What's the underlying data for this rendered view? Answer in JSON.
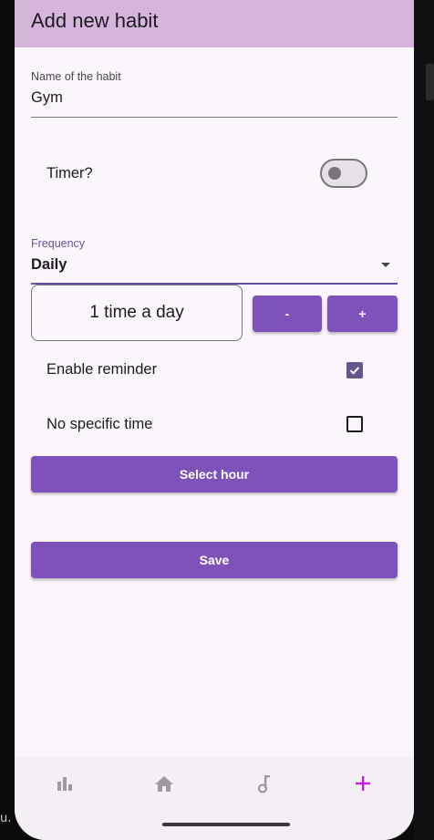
{
  "app_bar": {
    "title": "Add new habit"
  },
  "habit_name": {
    "label": "Name of the habit",
    "value": "Gym"
  },
  "timer": {
    "label": "Timer?",
    "enabled": false
  },
  "frequency": {
    "label": "Frequency",
    "value": "Daily"
  },
  "times_per_day": {
    "display": "1 time a day",
    "decrement_label": "-",
    "increment_label": "+"
  },
  "reminder": {
    "label": "Enable reminder",
    "checked": true
  },
  "no_specific_time": {
    "label": "No specific time",
    "checked": false
  },
  "select_hour": {
    "label": "Select hour"
  },
  "save": {
    "label": "Save"
  },
  "bottom_nav": {
    "items": [
      {
        "icon": "bar-chart-icon",
        "active": false
      },
      {
        "icon": "home-icon",
        "active": false
      },
      {
        "icon": "music-note-icon",
        "active": false
      },
      {
        "icon": "add-icon",
        "active": true
      }
    ]
  },
  "edge_text": "u.",
  "colors": {
    "app_bar": "#d6b5dc",
    "background": "#fdf5fc",
    "primary_button": "#7f52b9",
    "checkbox": "#65558f",
    "nav_active": "#c020d8",
    "nav_inactive": "#9e9aa2"
  }
}
